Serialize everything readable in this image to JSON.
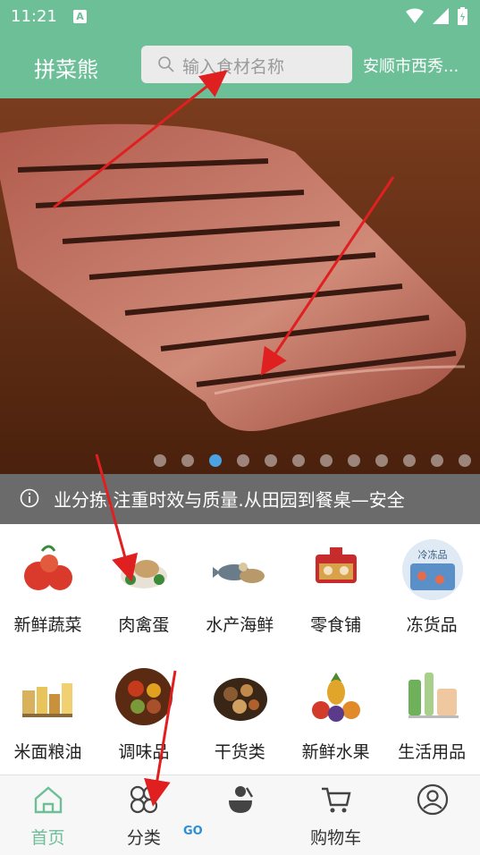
{
  "status_bar": {
    "time": "11:21",
    "app_indicator": "A"
  },
  "header": {
    "brand": "拼菜熊",
    "search_placeholder": "输入食材名称",
    "location": "安顺市西秀..."
  },
  "banner": {
    "slide_count": 12,
    "active_index": 2
  },
  "notice": {
    "icon": "info-icon",
    "text": "业分拣.注重时效与质量.从田园到餐桌—安全"
  },
  "categories": [
    {
      "label": "新鲜蔬菜",
      "icon": "vegetable-icon",
      "color": "#d93a2b"
    },
    {
      "label": "肉禽蛋",
      "icon": "meat-poultry-icon",
      "color": "#c9a06a"
    },
    {
      "label": "水产海鲜",
      "icon": "seafood-icon",
      "color": "#6a7c8a"
    },
    {
      "label": "零食铺",
      "icon": "snacks-icon",
      "color": "#d8a24a"
    },
    {
      "label": "冻货品",
      "icon": "frozen-goods-icon",
      "color": "#5b8fc8"
    },
    {
      "label": "米面粮油",
      "icon": "grain-oil-icon",
      "color": "#d7b15b"
    },
    {
      "label": "调味品",
      "icon": "seasoning-icon",
      "color": "#a8502a"
    },
    {
      "label": "干货类",
      "icon": "dried-goods-icon",
      "color": "#8a5a32"
    },
    {
      "label": "新鲜水果",
      "icon": "fruit-icon",
      "color": "#e0a52a"
    },
    {
      "label": "生活用品",
      "icon": "daily-goods-icon",
      "color": "#6fb05a"
    }
  ],
  "bottom_nav": [
    {
      "label": "首页",
      "icon": "home-icon",
      "active": true
    },
    {
      "label": "分类",
      "icon": "category-icon",
      "active": false
    },
    {
      "label": "",
      "icon": "recipe-icon",
      "active": false
    },
    {
      "label": "购物车",
      "icon": "cart-icon",
      "active": false
    },
    {
      "label": "",
      "icon": "profile-icon",
      "active": false
    }
  ],
  "colors": {
    "brand": "#6dbf98",
    "active_dot": "#4aa3e0",
    "annotation_arrow": "#e02020"
  },
  "watermark": "GO"
}
